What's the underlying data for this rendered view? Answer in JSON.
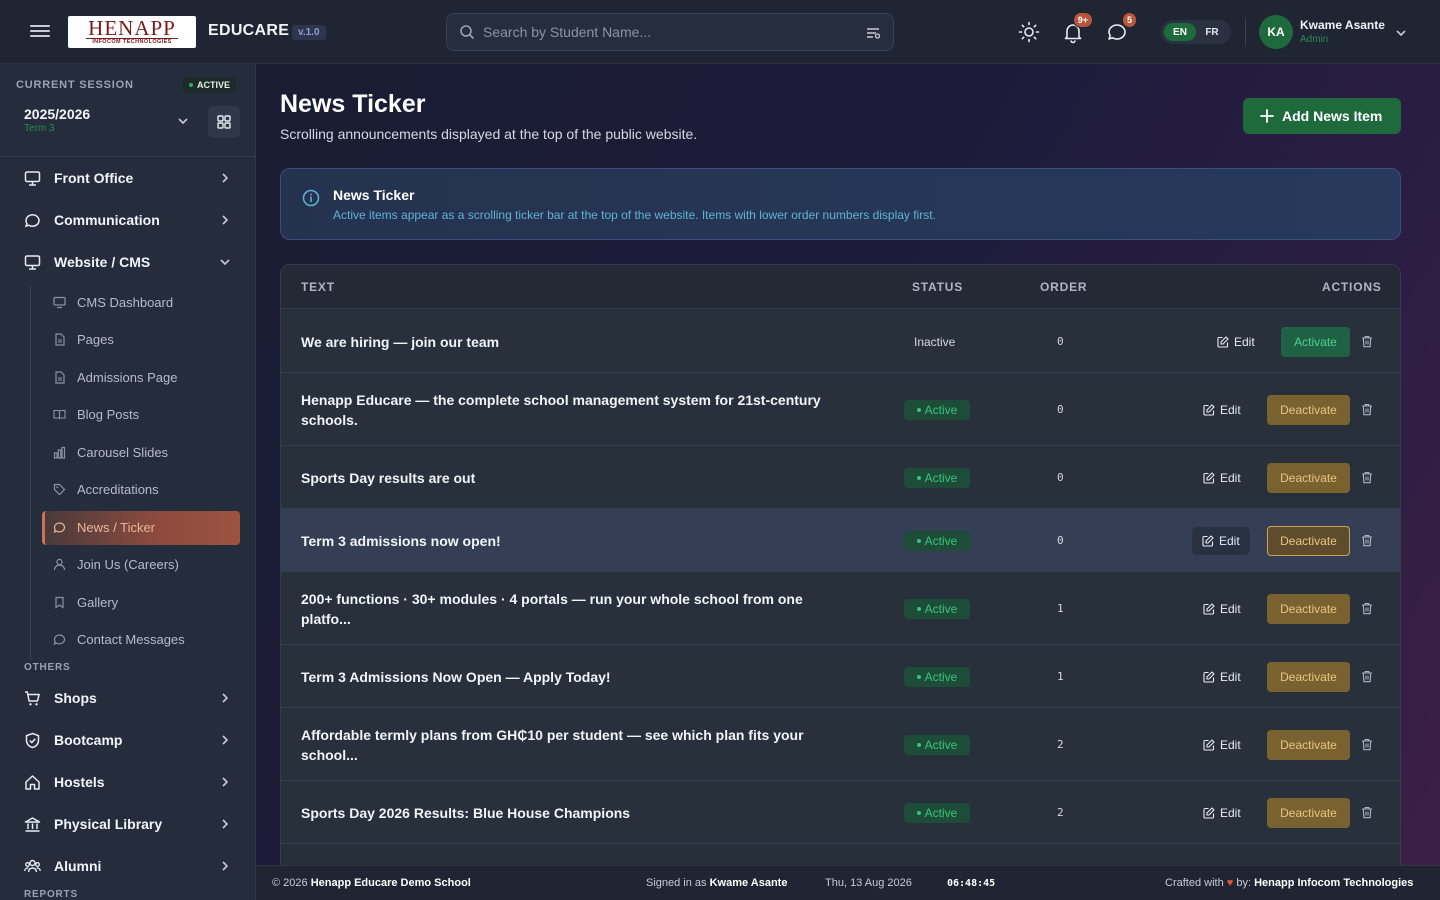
{
  "header": {
    "logo_main": "HENAPP",
    "logo_sub": "INFOCOM TECHNOLOGIES",
    "brand": "EDUCARE",
    "version": "v.1.0",
    "search_placeholder": "Search by Student Name...",
    "notifications_badge": "9+",
    "messages_badge": "5",
    "lang_en": "EN",
    "lang_fr": "FR",
    "avatar_initials": "KA",
    "user_name": "Kwame Asante",
    "user_role": "Admin"
  },
  "sidebar": {
    "session_label": "CURRENT SESSION",
    "session_badge": "ACTIVE",
    "session_year": "2025/2026",
    "session_term": "Term 3",
    "main_items": [
      {
        "label": "Front Office"
      },
      {
        "label": "Communication"
      },
      {
        "label": "Website / CMS"
      }
    ],
    "sub_items": [
      {
        "label": "CMS Dashboard"
      },
      {
        "label": "Pages"
      },
      {
        "label": "Admissions Page"
      },
      {
        "label": "Blog Posts"
      },
      {
        "label": "Carousel Slides"
      },
      {
        "label": "Accreditations"
      },
      {
        "label": "News / Ticker"
      },
      {
        "label": "Join Us (Careers)"
      },
      {
        "label": "Gallery"
      },
      {
        "label": "Contact Messages"
      }
    ],
    "others_label": "OTHERS",
    "other_items": [
      {
        "label": "Shops"
      },
      {
        "label": "Bootcamp"
      },
      {
        "label": "Hostels"
      },
      {
        "label": "Physical Library"
      },
      {
        "label": "Alumni"
      }
    ],
    "reports_label": "REPORTS"
  },
  "main": {
    "title": "News Ticker",
    "subtitle": "Scrolling announcements displayed at the top of the public website.",
    "add_button": "Add News Item",
    "info_title": "News Ticker",
    "info_text": "Active items appear as a scrolling ticker bar at the top of the website. Items with lower order numbers display first.",
    "table": {
      "headers": {
        "text": "TEXT",
        "status": "STATUS",
        "order": "ORDER",
        "actions": "ACTIONS"
      },
      "edit_label": "Edit",
      "activate_label": "Activate",
      "deactivate_label": "Deactivate",
      "rows": [
        {
          "text": "We are hiring — join our team",
          "status": "Inactive",
          "order": "0"
        },
        {
          "text": "Henapp Educare — the complete school management system for 21st-century schools.",
          "status": "Active",
          "order": "0"
        },
        {
          "text": "Sports Day results are out",
          "status": "Active",
          "order": "0"
        },
        {
          "text": "Term 3 admissions now open!",
          "status": "Active",
          "order": "0"
        },
        {
          "text": "200+ functions · 30+ modules · 4 portals — run your whole school from one platfo...",
          "status": "Active",
          "order": "1"
        },
        {
          "text": "Term 3 Admissions Now Open — Apply Today!",
          "status": "Active",
          "order": "1"
        },
        {
          "text": "Affordable termly plans from GH₵10 per student — see which plan fits your school...",
          "status": "Active",
          "order": "2"
        },
        {
          "text": "Sports Day 2026 Results: Blue House Champions",
          "status": "Active",
          "order": "2"
        }
      ]
    }
  },
  "footer": {
    "copyright": "© 2026",
    "school": "Henapp Educare Demo School",
    "signed_in_prefix": "Signed in as",
    "signed_in_user": "Kwame Asante",
    "date": "Thu, 13 Aug 2026",
    "time": "06:48:45",
    "crafted_prefix": "Crafted with",
    "crafted_by": "by:",
    "company": "Henapp Infocom Technologies"
  }
}
